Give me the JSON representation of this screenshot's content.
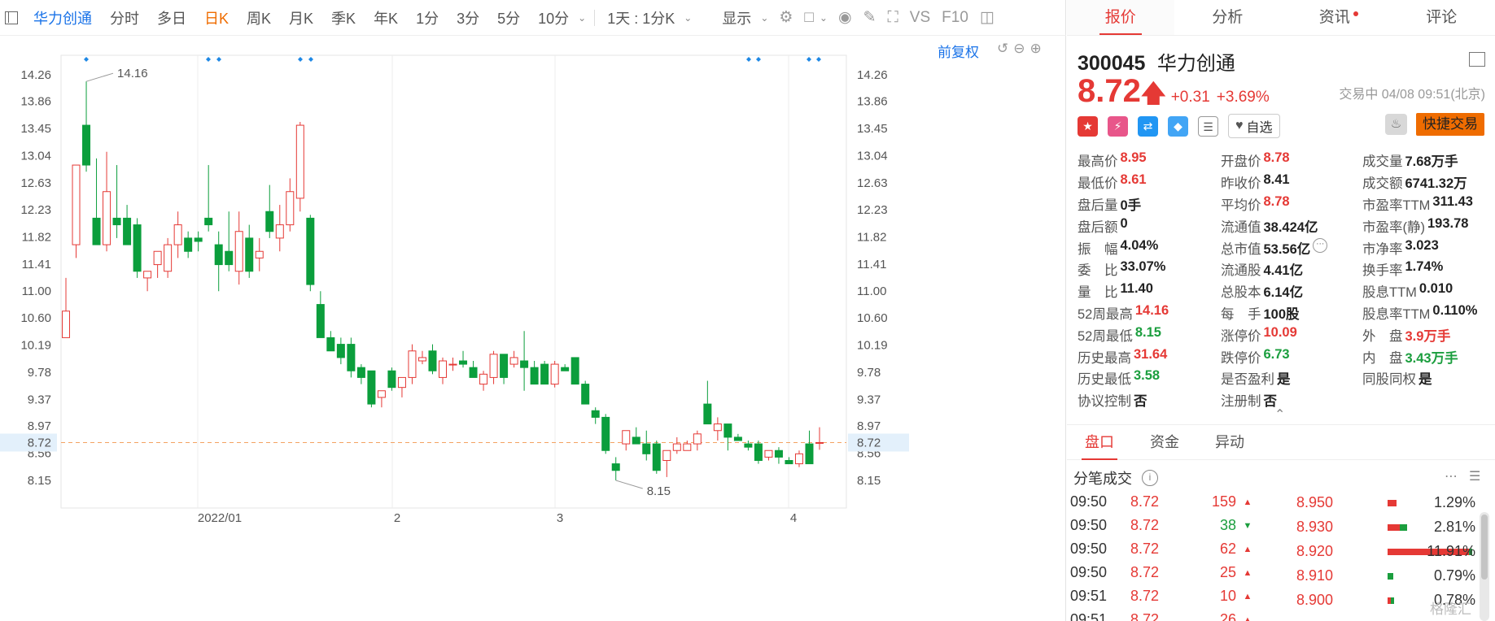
{
  "toolbar": {
    "stock_name": "华力创通",
    "periods": [
      "分时",
      "多日",
      "日K",
      "周K",
      "月K",
      "季K",
      "年K",
      "1分",
      "3分",
      "5分",
      "10分"
    ],
    "active_period": "日K",
    "range_select": "1天 : 1分K",
    "display_label": "显示",
    "vs_label": "VS",
    "f10_label": "F10"
  },
  "chart": {
    "fuquan_label": "前复权",
    "price_ticks": [
      "14.26",
      "13.86",
      "13.45",
      "13.04",
      "12.63",
      "12.23",
      "11.82",
      "11.41",
      "11.00",
      "10.60",
      "10.19",
      "9.78",
      "9.37",
      "8.97",
      "8.56",
      "8.15"
    ],
    "x_labels": [
      "2022/01",
      "2",
      "3",
      "4"
    ],
    "current_price_label": "8.72",
    "high_annotation": "14.16",
    "low_annotation": "8.15"
  },
  "chart_data": {
    "type": "candlestick",
    "title": "",
    "ylim": [
      8.0,
      14.4
    ],
    "current_price": 8.72,
    "x_tick_labels": [
      "2022/01",
      "2",
      "3",
      "4"
    ],
    "ohlc": [
      [
        10.3,
        11.2,
        10.3,
        10.7
      ],
      [
        11.7,
        12.9,
        11.5,
        12.9
      ],
      [
        13.5,
        14.16,
        12.8,
        12.9
      ],
      [
        12.1,
        13.0,
        11.8,
        11.7
      ],
      [
        11.7,
        13.1,
        11.6,
        12.5
      ],
      [
        12.1,
        12.9,
        11.8,
        12.0
      ],
      [
        12.1,
        12.3,
        11.7,
        11.7
      ],
      [
        12.0,
        12.1,
        11.2,
        11.3
      ],
      [
        11.2,
        11.3,
        11.0,
        11.3
      ],
      [
        11.4,
        11.6,
        11.2,
        11.6
      ],
      [
        11.3,
        11.8,
        11.2,
        11.7
      ],
      [
        11.7,
        12.2,
        11.5,
        12.0
      ],
      [
        11.8,
        11.9,
        11.5,
        11.6
      ],
      [
        11.8,
        11.9,
        11.6,
        11.75
      ],
      [
        12.1,
        12.9,
        11.9,
        12.0
      ],
      [
        11.7,
        11.9,
        11.0,
        11.4
      ],
      [
        11.6,
        12.2,
        11.3,
        11.4
      ],
      [
        11.3,
        12.2,
        11.1,
        11.9
      ],
      [
        11.8,
        12.0,
        11.2,
        11.3
      ],
      [
        11.5,
        11.8,
        11.3,
        11.6
      ],
      [
        12.2,
        12.6,
        11.8,
        11.9
      ],
      [
        11.8,
        12.3,
        11.6,
        12.0
      ],
      [
        12.0,
        12.7,
        11.9,
        12.5
      ],
      [
        12.4,
        13.55,
        12.2,
        13.5
      ],
      [
        12.1,
        12.15,
        11.0,
        11.1
      ],
      [
        10.8,
        11.0,
        10.3,
        10.3
      ],
      [
        10.3,
        10.4,
        10.1,
        10.1
      ],
      [
        10.2,
        10.3,
        9.9,
        10.0
      ],
      [
        10.2,
        10.3,
        9.7,
        9.8
      ],
      [
        9.85,
        9.9,
        9.6,
        9.7
      ],
      [
        9.8,
        9.8,
        9.25,
        9.3
      ],
      [
        9.4,
        9.5,
        9.25,
        9.5
      ],
      [
        9.8,
        9.85,
        9.5,
        9.55
      ],
      [
        9.55,
        9.7,
        9.4,
        9.7
      ],
      [
        9.7,
        10.2,
        9.6,
        10.1
      ],
      [
        9.95,
        10.1,
        9.9,
        10.0
      ],
      [
        10.1,
        10.2,
        9.75,
        9.8
      ],
      [
        9.7,
        10.0,
        9.6,
        9.95
      ],
      [
        9.9,
        10.0,
        9.8,
        9.9
      ],
      [
        9.95,
        10.1,
        9.85,
        9.9
      ],
      [
        9.85,
        9.95,
        9.7,
        9.7
      ],
      [
        9.6,
        9.8,
        9.5,
        9.75
      ],
      [
        9.7,
        10.1,
        9.6,
        10.05
      ],
      [
        10.05,
        10.05,
        9.6,
        9.7
      ],
      [
        9.9,
        10.1,
        9.85,
        10.0
      ],
      [
        9.95,
        10.4,
        9.5,
        9.85
      ],
      [
        9.85,
        9.95,
        9.6,
        9.6
      ],
      [
        9.9,
        9.95,
        9.6,
        9.6
      ],
      [
        9.6,
        9.95,
        9.55,
        9.9
      ],
      [
        9.85,
        9.9,
        9.8,
        9.8
      ],
      [
        10.0,
        10.0,
        9.6,
        9.6
      ],
      [
        9.6,
        9.65,
        9.3,
        9.3
      ],
      [
        9.2,
        9.25,
        9.0,
        9.1
      ],
      [
        9.1,
        9.15,
        8.55,
        8.6
      ],
      [
        8.4,
        8.5,
        8.15,
        8.3
      ],
      [
        8.7,
        8.9,
        8.6,
        8.9
      ],
      [
        8.8,
        8.95,
        8.7,
        8.7
      ],
      [
        8.7,
        8.9,
        8.45,
        8.55
      ],
      [
        8.7,
        8.75,
        8.25,
        8.3
      ],
      [
        8.45,
        8.6,
        8.2,
        8.6
      ],
      [
        8.6,
        8.8,
        8.55,
        8.7
      ],
      [
        8.6,
        8.75,
        8.6,
        8.7
      ],
      [
        8.7,
        8.9,
        8.6,
        8.85
      ],
      [
        9.3,
        9.65,
        9.0,
        9.0
      ],
      [
        8.9,
        9.1,
        8.75,
        9.0
      ],
      [
        9.0,
        9.0,
        8.6,
        8.8
      ],
      [
        8.8,
        8.85,
        8.75,
        8.75
      ],
      [
        8.7,
        8.75,
        8.6,
        8.65
      ],
      [
        8.7,
        8.75,
        8.4,
        8.45
      ],
      [
        8.5,
        8.6,
        8.45,
        8.6
      ],
      [
        8.6,
        8.65,
        8.4,
        8.5
      ],
      [
        8.45,
        8.5,
        8.4,
        8.4
      ],
      [
        8.4,
        8.6,
        8.35,
        8.55
      ],
      [
        8.7,
        8.9,
        8.4,
        8.4
      ],
      [
        8.72,
        8.95,
        8.61,
        8.72
      ]
    ]
  },
  "tabs": [
    {
      "label": "报价",
      "active": true
    },
    {
      "label": "分析",
      "active": false
    },
    {
      "label": "资讯",
      "active": false,
      "dot": true
    },
    {
      "label": "评论",
      "active": false
    }
  ],
  "quote": {
    "code": "300045",
    "name": "华力创通",
    "price": "8.72",
    "change": "+0.31",
    "change_pct": "+3.69%",
    "trade_time": "交易中 04/08 09:51(北京)",
    "watch_label": "自选",
    "quick_trade_label": "快捷交易"
  },
  "stats": [
    [
      {
        "label": "最高价",
        "value": "8.95",
        "color": "red"
      },
      {
        "label": "开盘价",
        "value": "8.78",
        "color": "red"
      },
      {
        "label": "成交量",
        "value": "7.68万手",
        "color": ""
      }
    ],
    [
      {
        "label": "最低价",
        "value": "8.61",
        "color": "red"
      },
      {
        "label": "昨收价",
        "value": "8.41",
        "color": ""
      },
      {
        "label": "成交额",
        "value": "6741.32万",
        "color": ""
      }
    ],
    [
      {
        "label": "盘后量",
        "value": "0手",
        "color": ""
      },
      {
        "label": "平均价",
        "value": "8.78",
        "color": "red"
      },
      {
        "label": "市盈率TTM",
        "value": "311.43",
        "color": ""
      }
    ],
    [
      {
        "label": "盘后额",
        "value": "0",
        "color": ""
      },
      {
        "label": "流通值",
        "value": "38.424亿",
        "color": ""
      },
      {
        "label": "市盈率(静)",
        "value": "193.78",
        "color": ""
      }
    ],
    [
      {
        "label": "振　幅",
        "value": "4.04%",
        "color": ""
      },
      {
        "label": "总市值",
        "value": "53.56亿",
        "color": "",
        "more": true
      },
      {
        "label": "市净率",
        "value": "3.023",
        "color": ""
      }
    ],
    [
      {
        "label": "委　比",
        "value": "33.07%",
        "color": ""
      },
      {
        "label": "流通股",
        "value": "4.41亿",
        "color": ""
      },
      {
        "label": "换手率",
        "value": "1.74%",
        "color": ""
      }
    ],
    [
      {
        "label": "量　比",
        "value": "11.40",
        "color": ""
      },
      {
        "label": "总股本",
        "value": "6.14亿",
        "color": ""
      },
      {
        "label": "股息TTM",
        "value": "0.010",
        "color": ""
      }
    ],
    [
      {
        "label": "52周最高",
        "value": "14.16",
        "color": "red"
      },
      {
        "label": "每　手",
        "value": "100股",
        "color": ""
      },
      {
        "label": "股息率TTM",
        "value": "0.110%",
        "color": ""
      }
    ],
    [
      {
        "label": "52周最低",
        "value": "8.15",
        "color": "green"
      },
      {
        "label": "涨停价",
        "value": "10.09",
        "color": "red"
      },
      {
        "label": "外　盘",
        "value": "3.9万手",
        "color": "red"
      }
    ],
    [
      {
        "label": "历史最高",
        "value": "31.64",
        "color": "red"
      },
      {
        "label": "跌停价",
        "value": "6.73",
        "color": "green"
      },
      {
        "label": "内　盘",
        "value": "3.43万手",
        "color": "green"
      }
    ],
    [
      {
        "label": "历史最低",
        "value": "3.58",
        "color": "green"
      },
      {
        "label": "是否盈利",
        "value": "是",
        "color": ""
      },
      {
        "label": "同股同权",
        "value": "是",
        "color": ""
      }
    ],
    [
      {
        "label": "协议控制",
        "value": "否",
        "color": ""
      },
      {
        "label": "注册制",
        "value": "否",
        "color": ""
      },
      {
        "label": "",
        "value": "",
        "color": ""
      }
    ]
  ],
  "sub_tabs": [
    {
      "label": "盘口",
      "active": true
    },
    {
      "label": "资金",
      "active": false
    },
    {
      "label": "异动",
      "active": false
    }
  ],
  "ticks_title": "分笔成交",
  "ticks": [
    {
      "time": "09:50",
      "price": "8.72",
      "vol": "159",
      "dir": "up"
    },
    {
      "time": "09:50",
      "price": "8.72",
      "vol": "38",
      "dir": "dn"
    },
    {
      "time": "09:50",
      "price": "8.72",
      "vol": "62",
      "dir": "up"
    },
    {
      "time": "09:50",
      "price": "8.72",
      "vol": "25",
      "dir": "up"
    },
    {
      "time": "09:51",
      "price": "8.72",
      "vol": "10",
      "dir": "up"
    },
    {
      "time": "09:51",
      "price": "8.72",
      "vol": "26",
      "dir": "up"
    }
  ],
  "distribution": [
    {
      "price": "8.950",
      "pct": "1.29%",
      "red": 0.0129,
      "green": 0
    },
    {
      "price": "8.930",
      "pct": "2.81%",
      "red": 0.018,
      "green": 0.0101
    },
    {
      "price": "8.920",
      "pct": "11.91%",
      "red": 0.1191,
      "green": 0.002
    },
    {
      "price": "8.910",
      "pct": "0.79%",
      "red": 0,
      "green": 0.0079
    },
    {
      "price": "8.900",
      "pct": "0.78%",
      "red": 0.004,
      "green": 0.0038
    }
  ],
  "watermark": "格隆汇"
}
